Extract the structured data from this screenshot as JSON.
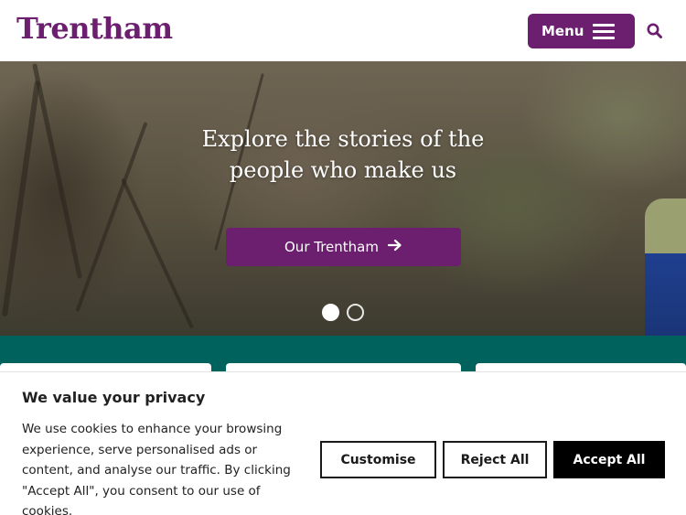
{
  "header": {
    "logo_text": "Trentham",
    "menu_label": "Menu",
    "menu_icon": "hamburger-icon",
    "search_icon": "search-icon"
  },
  "hero": {
    "title_line1": "Explore the stories of the",
    "title_line2": "people who make us",
    "button_label": "Our Trentham",
    "button_icon": "arrow-right-icon",
    "slides": {
      "count": 2,
      "active_index": 0
    }
  },
  "cookie_banner": {
    "title": "We value your privacy",
    "body": "We use cookies to enhance your browsing experience, serve personalised ads or content, and analyse our traffic. By clicking \"Accept All\", you consent to our use of cookies.",
    "customise_label": "Customise",
    "reject_label": "Reject All",
    "accept_label": "Accept All"
  },
  "colors": {
    "brand_purple": "#6b1f6e",
    "teal": "#00625d",
    "accept_bg": "#000000"
  }
}
